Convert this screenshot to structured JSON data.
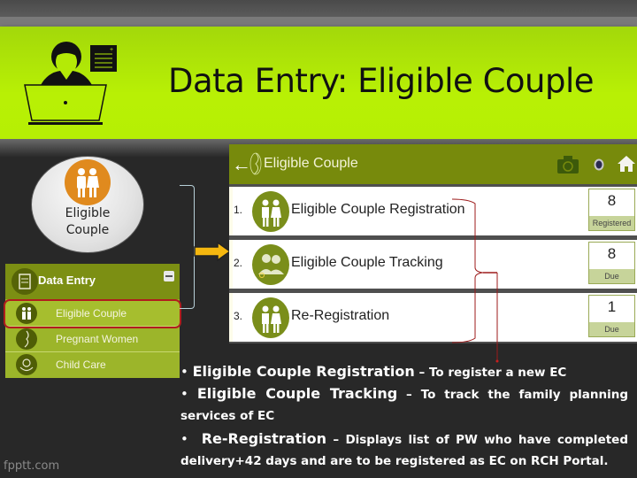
{
  "slide": {
    "title": "Data Entry: Eligible Couple",
    "header_icon": "person-at-laptop-with-document-icon",
    "watermark": "fpptt.com"
  },
  "circle": {
    "icon": "couple-icon",
    "label_line1": "Eligible",
    "label_line2": "Couple",
    "icon_color": "#e08a1e"
  },
  "menu": {
    "header_label": "Data Entry",
    "header_icon": "document-icon",
    "collapse_icon": "minus-icon",
    "items": [
      {
        "label": "Eligible Couple",
        "icon": "couple-icon",
        "selected": true
      },
      {
        "label": "Pregnant Women",
        "icon": "pregnant-woman-icon",
        "selected": false
      },
      {
        "label": "Child Care",
        "icon": "child-care-icon",
        "selected": false
      }
    ],
    "accent_color": "#9cb52a",
    "selection_color": "#b11d1d"
  },
  "app": {
    "back_icon": "back-arrow-icon",
    "title": "Eligible Couple",
    "toolbar_icons": [
      "camera-icon",
      "record-icon",
      "home-icon"
    ],
    "bar_color": "#778a0c",
    "rows": [
      {
        "number": "1.",
        "label": "Eligible Couple Registration",
        "icon": "couple-icon",
        "count": "8",
        "count_label": "Registered"
      },
      {
        "number": "2.",
        "label": "Eligible Couple Tracking",
        "icon": "couple-search-icon",
        "count": "8",
        "count_label": "Due"
      },
      {
        "number": "3.",
        "label": "Re-Registration",
        "icon": "couple-icon",
        "count": "1",
        "count_label": "Due"
      }
    ]
  },
  "description": [
    {
      "title": "Eligible Couple Registration",
      "dash": " – ",
      "text": "To register a new EC"
    },
    {
      "title": "Eligible Couple Tracking",
      "dash": " – ",
      "text": "To track the family planning services of EC"
    },
    {
      "title": "Re-Registration",
      "dash": " – ",
      "text": "Displays list of PW who have completed delivery+42 days and are to be registered as EC on RCH Portal."
    }
  ]
}
